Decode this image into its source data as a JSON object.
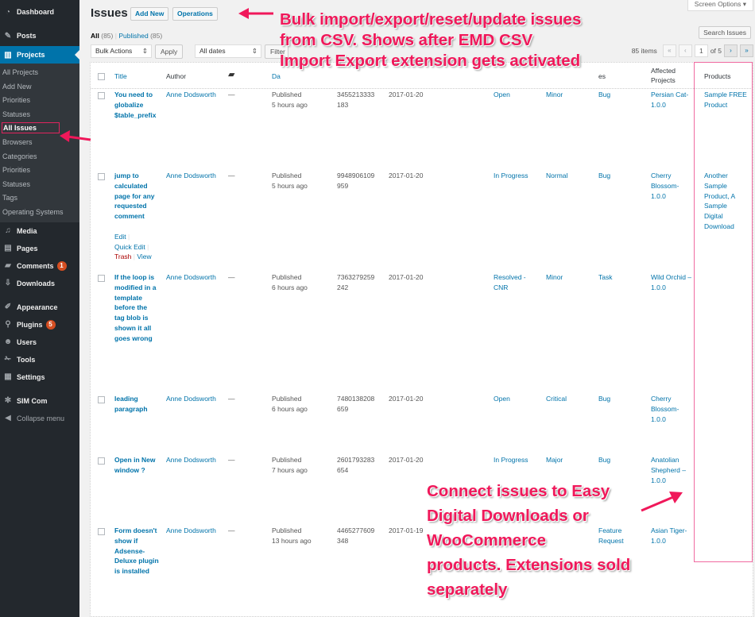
{
  "sidebar": {
    "items": [
      {
        "label": "Dashboard",
        "icon": "dashboard-icon",
        "glyph": "◔"
      },
      {
        "label": "Posts",
        "icon": "pin-icon",
        "glyph": "✎"
      },
      {
        "label": "Projects",
        "icon": "projects-icon",
        "glyph": "▥"
      },
      {
        "label": "Media",
        "icon": "media-icon",
        "glyph": "♫"
      },
      {
        "label": "Pages",
        "icon": "pages-icon",
        "glyph": "▤"
      },
      {
        "label": "Comments",
        "icon": "comment-icon",
        "glyph": "▰",
        "badge": "1"
      },
      {
        "label": "Downloads",
        "icon": "download-icon",
        "glyph": "⇩"
      },
      {
        "label": "Appearance",
        "icon": "brush-icon",
        "glyph": "✐"
      },
      {
        "label": "Plugins",
        "icon": "plugin-icon",
        "glyph": "⚲",
        "badge": "5"
      },
      {
        "label": "Users",
        "icon": "user-icon",
        "glyph": "☻"
      },
      {
        "label": "Tools",
        "icon": "wrench-icon",
        "glyph": "✁"
      },
      {
        "label": "Settings",
        "icon": "settings-icon",
        "glyph": "▦"
      },
      {
        "label": "SIM Com",
        "icon": "gear-icon",
        "glyph": "✻"
      },
      {
        "label": "Collapse menu",
        "icon": "collapse-icon",
        "glyph": "◀"
      }
    ],
    "projects_submenu": [
      "All Projects",
      "Add New",
      "Priorities",
      "Statuses",
      "All Issues",
      "Browsers",
      "Categories",
      "Priorities",
      "Statuses",
      "Tags",
      "Operating Systems"
    ],
    "current_submenu": "All Issues"
  },
  "header": {
    "title": "Issues",
    "add_new": "Add New",
    "operations": "Operations",
    "screen_options": "Screen Options ▾"
  },
  "filters": {
    "all_label": "All",
    "all_count": "(85)",
    "separator": "|",
    "published_label": "Published",
    "published_count": "(85)",
    "search_button": "Search Issues",
    "bulk_actions": "Bulk Actions",
    "apply": "Apply",
    "all_dates": "All dates",
    "filter": "Filter"
  },
  "pagination": {
    "items": "85 items",
    "first": "«",
    "prev": "‹",
    "current_page": "1",
    "of_total": "of 5",
    "next": "›",
    "last": "»"
  },
  "table": {
    "columns": {
      "title": "Title",
      "author": "Author",
      "comments_icon": "comment-bubble-icon",
      "date": "Da",
      "affected_projects_1": "Affected",
      "affected_projects_2": "Projects",
      "types_partial": "es",
      "products": "Products"
    },
    "row_actions": {
      "edit": "Edit",
      "quick_edit": "Quick Edit",
      "trash": "Trash",
      "view": "View"
    },
    "rows": [
      {
        "title": "You need to globalize $table_prefix",
        "author": "Anne Dodsworth",
        "comments": "—",
        "status": "Published",
        "age": "5 hours ago",
        "id_a": "3455213333",
        "id_b": "183",
        "date": "2017-01-20",
        "issue_status": "Open",
        "priority": "Minor",
        "type": "Bug",
        "project": "Persian Cat-1.0.0",
        "products": "Sample FREE Product"
      },
      {
        "title": "jump to calculated page for any requested comment",
        "author": "Anne Dodsworth",
        "comments": "—",
        "status": "Published",
        "age": "5 hours ago",
        "id_a": "9948906109",
        "id_b": "959",
        "date": "2017-01-20",
        "issue_status": "In Progress",
        "priority": "Normal",
        "type": "Bug",
        "project": "Cherry Blossom-1.0.0",
        "products": "Another Sample Product, A Sample Digital Download",
        "show_actions": true
      },
      {
        "title": "If the loop is modified in a template before the tag blob is shown it all goes wrong",
        "author": "Anne Dodsworth",
        "comments": "—",
        "status": "Published",
        "age": "6 hours ago",
        "id_a": "7363279259",
        "id_b": "242",
        "date": "2017-01-20",
        "issue_status": "Resolved - CNR",
        "priority": "Minor",
        "type": "Task",
        "project": "Wild Orchid – 1.0.0",
        "products": ""
      },
      {
        "title": "leading paragraph",
        "author": "Anne Dodsworth",
        "comments": "—",
        "status": "Published",
        "age": "6 hours ago",
        "id_a": "7480138208",
        "id_b": "659",
        "date": "2017-01-20",
        "issue_status": "Open",
        "priority": "Critical",
        "type": "Bug",
        "project": "Cherry Blossom-1.0.0",
        "products": ""
      },
      {
        "title": "Open in New window ?",
        "author": "Anne Dodsworth",
        "comments": "—",
        "status": "Published",
        "age": "7 hours ago",
        "id_a": "2601793283",
        "id_b": "654",
        "date": "2017-01-20",
        "issue_status": "In Progress",
        "priority": "Major",
        "type": "Bug",
        "project": "Anatolian Shepherd – 1.0.0",
        "products": ""
      },
      {
        "title": "Form doesn't show if Adsense-Deluxe plugin is installed",
        "author": "Anne Dodsworth",
        "comments": "—",
        "status": "Published",
        "age": "13 hours ago",
        "id_a": "4465277609",
        "id_b": "348",
        "date": "2017-01-19",
        "issue_status": "",
        "priority": "",
        "type": "Feature Request",
        "project": "Asian Tiger-1.0.0",
        "products": ""
      }
    ]
  },
  "annotations": {
    "top": [
      "Bulk import/export/reset/update issues",
      "from CSV. Shows after EMD CSV",
      "Import Export extension gets activated"
    ],
    "bottom": [
      "Connect issues to Easy",
      "Digital Downloads or",
      "WooCommerce",
      "products. Extensions sold",
      "separately"
    ],
    "color": "#f0185a"
  },
  "colors": {
    "sidebar_bg": "#23282d",
    "sidebar_active": "#0073aa",
    "link": "#0073aa",
    "highlight_box": "#f06aa0"
  }
}
